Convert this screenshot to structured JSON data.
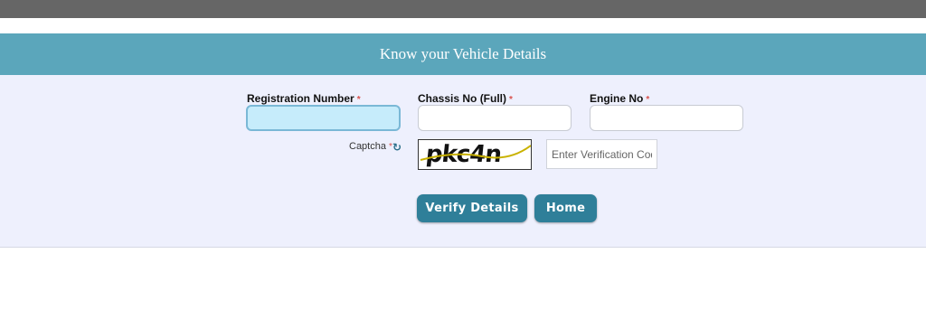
{
  "header": {
    "title": "Know your Vehicle Details"
  },
  "form": {
    "registration_label": "Registration Number",
    "chassis_label": "Chassis No (Full)",
    "engine_label": "Engine No",
    "required_mark": "*",
    "registration_value": "",
    "chassis_value": "",
    "engine_value": "",
    "captcha_label": "Captcha",
    "captcha_text": "pkc4n",
    "verification_placeholder": "Enter Verification Code"
  },
  "buttons": {
    "verify_label": "Verify Details",
    "home_label": "Home"
  },
  "icons": {
    "refresh": "refresh-icon"
  },
  "colors": {
    "header_bg": "#5ba6bb",
    "panel_bg": "#eef0fd",
    "button_bg": "#2f7f99",
    "active_field_bg": "#c6ecfb",
    "top_bar": "#666666"
  }
}
